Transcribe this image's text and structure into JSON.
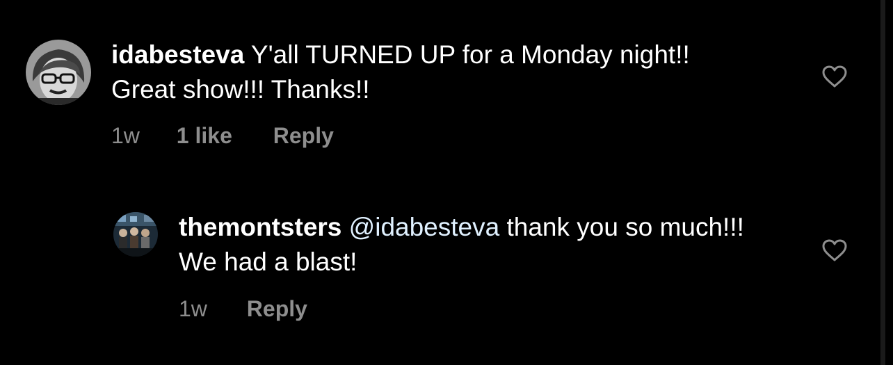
{
  "comments": [
    {
      "username": "idabesteva",
      "text": "Y'all TURNED UP for a Monday night!! Great show!!! Thanks!!",
      "time": "1w",
      "likes": "1 like",
      "reply_label": "Reply",
      "like_icon": "heart-outline-icon"
    },
    {
      "username": "themontsters",
      "mention": "@idabesteva",
      "text": "thank you so much!!! We had a blast!",
      "time": "1w",
      "reply_label": "Reply",
      "like_icon": "heart-outline-icon"
    }
  ],
  "colors": {
    "background": "#000000",
    "text": "#ffffff",
    "muted": "#8e8e8e",
    "mention": "#e0f1ff"
  }
}
